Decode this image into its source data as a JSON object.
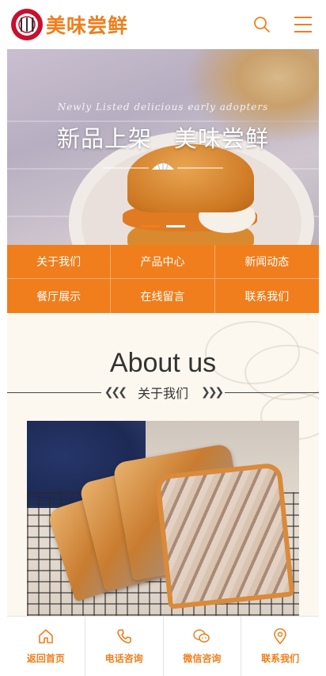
{
  "header": {
    "brand": "美味尝鲜",
    "logo_icon": "plate-fork-knife-icon",
    "search_icon": "search-icon",
    "menu_icon": "hamburger-menu-icon"
  },
  "banner": {
    "script_text": "Newly Listed delicious early adopters",
    "title_left": "新品上架",
    "title_right": "美味尝鲜",
    "slide_count": 2,
    "active_slide": 1
  },
  "nav": {
    "items": [
      {
        "label": "关于我们"
      },
      {
        "label": "产品中心"
      },
      {
        "label": "新闻动态"
      },
      {
        "label": "餐厅展示"
      },
      {
        "label": "在线留言"
      },
      {
        "label": "联系我们"
      }
    ]
  },
  "about": {
    "title": "About us",
    "subtitle": "关于我们"
  },
  "bottom_bar": {
    "items": [
      {
        "label": "返回首页",
        "icon": "home-icon"
      },
      {
        "label": "电话咨询",
        "icon": "phone-icon"
      },
      {
        "label": "微信咨询",
        "icon": "wechat-icon"
      },
      {
        "label": "联系我们",
        "icon": "location-pin-icon"
      }
    ]
  },
  "colors": {
    "accent": "#f07e1c",
    "logo_red": "#c8102e",
    "section_bg": "#fcf8f0"
  }
}
